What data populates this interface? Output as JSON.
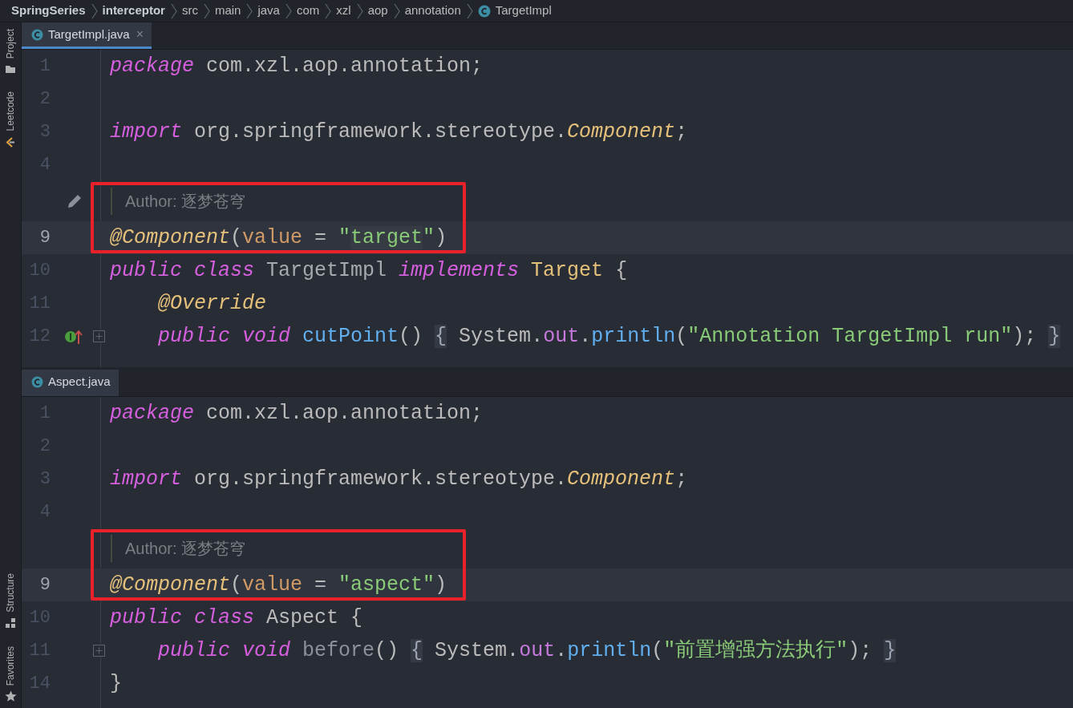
{
  "breadcrumbs": [
    {
      "label": "SpringSeries",
      "kind": "project"
    },
    {
      "label": "interceptor",
      "kind": "module"
    },
    {
      "label": "src",
      "kind": "folder"
    },
    {
      "label": "main",
      "kind": "folder"
    },
    {
      "label": "java",
      "kind": "folder"
    },
    {
      "label": "com",
      "kind": "folder"
    },
    {
      "label": "xzl",
      "kind": "folder"
    },
    {
      "label": "aop",
      "kind": "folder"
    },
    {
      "label": "annotation",
      "kind": "folder"
    },
    {
      "label": "TargetImpl",
      "kind": "class"
    }
  ],
  "tool_strip": {
    "top": [
      {
        "label": "Project",
        "kind": "folder"
      },
      {
        "label": "Leetcode",
        "kind": "leetcode"
      }
    ],
    "bottom": [
      {
        "label": "Structure",
        "kind": "structure"
      },
      {
        "label": "Favorites",
        "kind": "star"
      }
    ]
  },
  "editors": [
    {
      "tab": {
        "label": "TargetImpl.java",
        "selected": true,
        "focused": true,
        "close": "×"
      },
      "lines": [
        {
          "number": "1",
          "tokens": [
            {
              "t": "package",
              "kind": "kw"
            },
            {
              "t": " com.xzl.aop.annotation;",
              "kind": "plain"
            }
          ]
        },
        {
          "number": "2"
        },
        {
          "number": "3",
          "tokens": [
            {
              "t": "import",
              "kind": "kw"
            },
            {
              "t": " org.springframework.stereotype.",
              "kind": "plain"
            },
            {
              "t": "Component",
              "kind": "icls"
            },
            {
              "t": ";",
              "kind": "plain"
            }
          ]
        },
        {
          "number": "4"
        },
        {
          "kind": "author",
          "text": "Author: 逐梦苍穹",
          "gutter_icon": {
            "kind": "pencil"
          },
          "boxed": true
        },
        {
          "number": "9",
          "current": true,
          "boxed": true,
          "tokens": [
            {
              "t": "@Component",
              "kind": "ann"
            },
            {
              "t": "(",
              "kind": "plain"
            },
            {
              "t": "value",
              "kind": "param"
            },
            {
              "t": " = ",
              "kind": "plain"
            },
            {
              "t": "\"",
              "kind": "str"
            },
            {
              "t": "target",
              "kind": "strhl"
            },
            {
              "t": "\"",
              "kind": "str"
            },
            {
              "t": ")",
              "kind": "plain"
            }
          ]
        },
        {
          "number": "10",
          "tokens": [
            {
              "t": "public ",
              "kind": "kw"
            },
            {
              "t": "class",
              "kind": "kw"
            },
            {
              "t": " TargetImpl ",
              "kind": "cls"
            },
            {
              "t": "implements ",
              "kind": "kw"
            },
            {
              "t": "Target",
              "kind": "iface"
            },
            {
              "t": " {",
              "kind": "plain"
            }
          ]
        },
        {
          "number": "11",
          "tokens": [
            {
              "t": "    @Override",
              "kind": "ann"
            }
          ]
        },
        {
          "number": "12",
          "gutter_icon": {
            "kind": "implements"
          },
          "fold": true,
          "tokens": [
            {
              "t": "    public ",
              "kind": "kw"
            },
            {
              "t": "void ",
              "kind": "kw"
            },
            {
              "t": "cutPoint",
              "kind": "method"
            },
            {
              "t": "() ",
              "kind": "plain"
            },
            {
              "t": "{",
              "kind": "brace"
            },
            {
              "t": " System.",
              "kind": "plain"
            },
            {
              "t": "out",
              "kind": "field"
            },
            {
              "t": ".",
              "kind": "plain"
            },
            {
              "t": "println",
              "kind": "method"
            },
            {
              "t": "(",
              "kind": "plain"
            },
            {
              "t": "\"Annotation TargetImpl run\"",
              "kind": "str"
            },
            {
              "t": "); ",
              "kind": "plain"
            },
            {
              "t": "}",
              "kind": "brace"
            }
          ]
        }
      ]
    },
    {
      "tab": {
        "label": "Aspect.java",
        "selected": true,
        "focused": false
      },
      "lines": [
        {
          "number": "1",
          "tokens": [
            {
              "t": "package",
              "kind": "kw"
            },
            {
              "t": " com.xzl.aop.annotation;",
              "kind": "plain"
            }
          ]
        },
        {
          "number": "2"
        },
        {
          "number": "3",
          "tokens": [
            {
              "t": "import",
              "kind": "kw"
            },
            {
              "t": " org.springframework.stereotype.",
              "kind": "plain"
            },
            {
              "t": "Component",
              "kind": "icls"
            },
            {
              "t": ";",
              "kind": "plain"
            }
          ]
        },
        {
          "number": "4"
        },
        {
          "kind": "author",
          "text": "Author: 逐梦苍穹",
          "boxed": true
        },
        {
          "number": "9",
          "current": true,
          "boxed": true,
          "tokens": [
            {
              "t": "@Component",
              "kind": "ann"
            },
            {
              "t": "(",
              "kind": "plain"
            },
            {
              "t": "value",
              "kind": "param"
            },
            {
              "t": " = ",
              "kind": "plain"
            },
            {
              "t": "\"aspect\"",
              "kind": "str"
            },
            {
              "t": ")",
              "kind": "plain"
            }
          ]
        },
        {
          "number": "10",
          "tokens": [
            {
              "t": "public ",
              "kind": "kw"
            },
            {
              "t": "class",
              "kind": "kw"
            },
            {
              "t": " Aspect {",
              "kind": "plain"
            }
          ]
        },
        {
          "number": "11",
          "fold": true,
          "tokens": [
            {
              "t": "    public ",
              "kind": "kw"
            },
            {
              "t": "void ",
              "kind": "kw"
            },
            {
              "t": "before",
              "kind": "unused"
            },
            {
              "t": "() ",
              "kind": "plain"
            },
            {
              "t": "{",
              "kind": "brace"
            },
            {
              "t": " System.",
              "kind": "plain"
            },
            {
              "t": "out",
              "kind": "field"
            },
            {
              "t": ".",
              "kind": "plain"
            },
            {
              "t": "println",
              "kind": "method"
            },
            {
              "t": "(",
              "kind": "plain"
            },
            {
              "t": "\"前置增强方法执行\"",
              "kind": "str"
            },
            {
              "t": "); ",
              "kind": "plain"
            },
            {
              "t": "}",
              "kind": "brace"
            }
          ]
        },
        {
          "number": "14",
          "tokens": [
            {
              "t": "}",
              "kind": "plain"
            }
          ]
        }
      ]
    }
  ]
}
